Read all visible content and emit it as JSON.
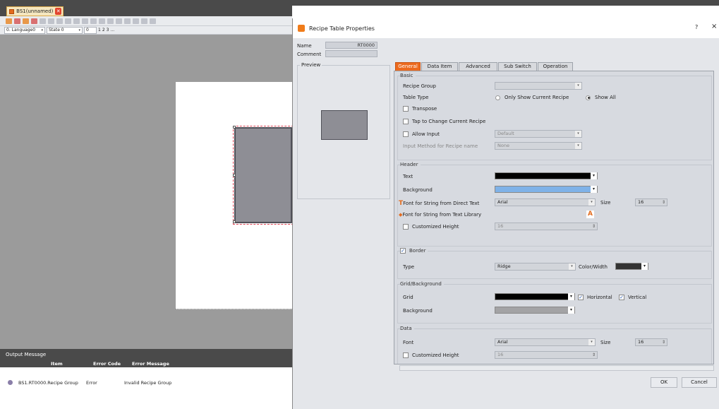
{
  "doc_tab": {
    "title": "BS1(unnamed)"
  },
  "toolbar": {
    "language": "0. Language0",
    "state": "State 0",
    "layer_selected": "0",
    "layers": [
      "1",
      "2",
      "3"
    ],
    "extra": "..."
  },
  "output": {
    "title": "Output Message",
    "columns": [
      "Item",
      "Error Code",
      "Error Message"
    ],
    "rows": [
      {
        "item": "BS1.RT0000.Recipe Group",
        "code": "Error",
        "message": "Invalid Recipe Group"
      }
    ]
  },
  "dialog": {
    "title": "Recipe Table Properties",
    "help": "?",
    "close": "×",
    "name_label": "Name",
    "name_value": "RT0000",
    "comment_label": "Comment",
    "comment_value": "",
    "preview_label": "Preview",
    "tabs": [
      "General",
      "Data Item",
      "Advanced",
      "Sub Switch",
      "Operation"
    ],
    "active_tab": "General",
    "basic": {
      "title": "Basic",
      "recipe_group_label": "Recipe Group",
      "recipe_group_value": "",
      "table_type_label": "Table Type",
      "table_type_options": [
        "Only Show Current Recipe",
        "Show All"
      ],
      "table_type_selected": "Show All",
      "transpose": "Transpose",
      "tap_change": "Tap to Change Current Recipe",
      "allow_input": "Allow Input",
      "allow_input_value": "Default",
      "input_method_label": "Input Method for Recipe name",
      "input_method_value": "None"
    },
    "header": {
      "title": "Header",
      "text_label": "Text",
      "text_color": "#000000",
      "background_label": "Background",
      "background_color": "#7fb2e8",
      "font_direct_label": "Font for String from Direct Text",
      "font_direct_value": "Arial",
      "size_label": "Size",
      "size_value": "16",
      "font_library_label": "Font for String from Text Library",
      "customized_height": "Customized Height",
      "customized_height_value": "16"
    },
    "border": {
      "title": "Border",
      "checked": true,
      "type_label": "Type",
      "type_value": "Ridge",
      "color_width_label": "Color/Width",
      "color": "#333333"
    },
    "grid": {
      "title": "Grid/Background",
      "grid_label": "Grid",
      "grid_color": "#000000",
      "horizontal": "Horizontal",
      "vertical": "Vertical",
      "background_label": "Background",
      "background_color": "#a3a3a5"
    },
    "data": {
      "title": "Data",
      "font_label": "Font",
      "font_value": "Arial",
      "size_label": "Size",
      "size_value": "16",
      "customized_height": "Customized Height",
      "customized_height_value": "16"
    },
    "ok": "OK",
    "cancel": "Cancel"
  }
}
